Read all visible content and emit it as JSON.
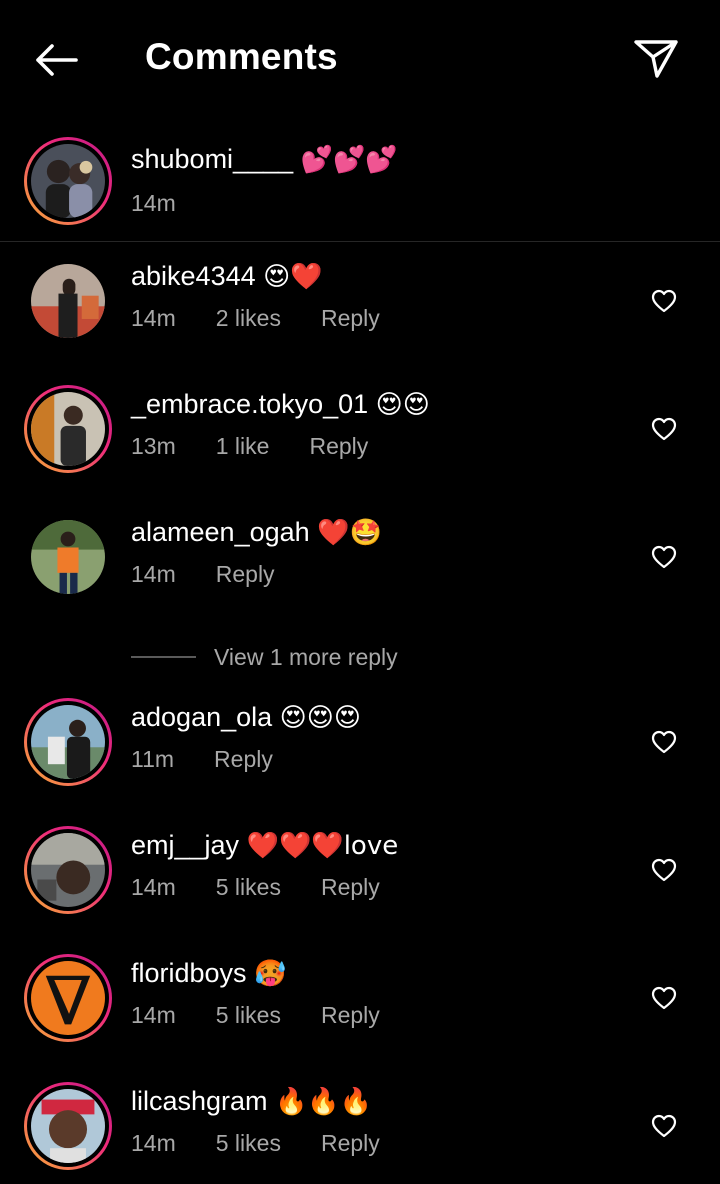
{
  "header": {
    "title": "Comments",
    "back_icon": "arrow-left-icon",
    "send_icon": "paper-plane-icon"
  },
  "caption": {
    "username": "shubomi____",
    "emoji": "💕💕💕",
    "time": "14m"
  },
  "comments": [
    {
      "username": "abike4344",
      "text": "😍❤️",
      "time": "14m",
      "likes": "2 likes",
      "reply": "Reply",
      "ring": false
    },
    {
      "username": "_embrace.tokyo_01",
      "text": "😍😍",
      "time": "13m",
      "likes": "1 like",
      "reply": "Reply",
      "ring": true
    },
    {
      "username": "alameen_ogah",
      "text": "❤️🤩",
      "time": "14m",
      "likes": "",
      "reply": "Reply",
      "ring": false
    },
    {
      "username": "adogan_ola",
      "text": "😍😍😍",
      "time": "11m",
      "likes": "",
      "reply": "Reply",
      "ring": true
    },
    {
      "username": "emj__jay",
      "text": "❤️❤️❤️love",
      "time": "14m",
      "likes": "5 likes",
      "reply": "Reply",
      "ring": true
    },
    {
      "username": "floridboys",
      "text": "🥵",
      "time": "14m",
      "likes": "5 likes",
      "reply": "Reply",
      "ring": true
    },
    {
      "username": "lilcashgram",
      "text": "🔥🔥🔥",
      "time": "14m",
      "likes": "5 likes",
      "reply": "Reply",
      "ring": true
    }
  ],
  "view_more": "View 1 more reply",
  "colors": {
    "background": "#000000",
    "secondary_text": "#a8a8a8",
    "ring_start": "#f9b233",
    "ring_end": "#bc1888"
  }
}
